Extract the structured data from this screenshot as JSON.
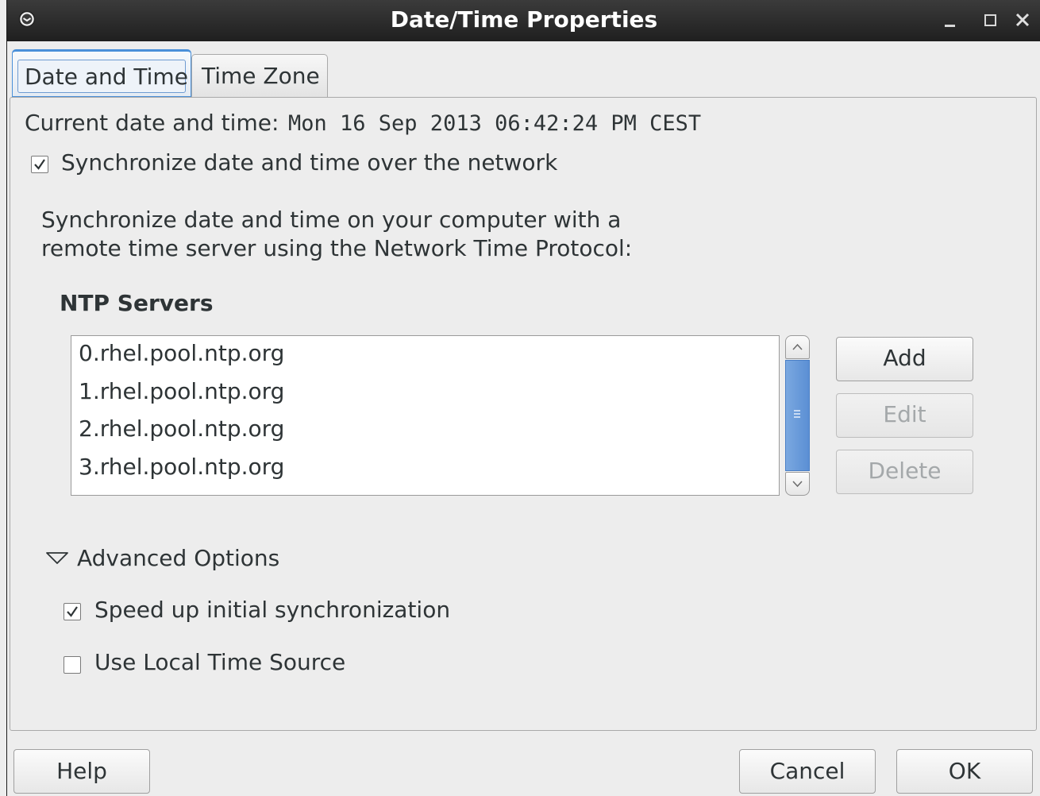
{
  "window": {
    "title": "Date/Time Properties"
  },
  "tabs": [
    {
      "label": "Date and Time",
      "active": true
    },
    {
      "label": "Time Zone",
      "active": false
    }
  ],
  "current": {
    "label": "Current date and time:",
    "value": "Mon 16 Sep 2013 06:42:24 PM CEST"
  },
  "sync": {
    "label": "Synchronize date and time over the network",
    "checked": true,
    "description_line1": "Synchronize date and time on your computer with a",
    "description_line2": "remote time server using the Network Time Protocol:"
  },
  "ntp": {
    "heading": "NTP Servers",
    "servers": [
      "0.rhel.pool.ntp.org",
      "1.rhel.pool.ntp.org",
      "2.rhel.pool.ntp.org",
      "3.rhel.pool.ntp.org"
    ],
    "add_label": "Add",
    "edit_label": "Edit",
    "delete_label": "Delete"
  },
  "advanced": {
    "label": "Advanced Options",
    "expanded": true,
    "speed_up_label": "Speed up initial synchronization",
    "speed_up_checked": true,
    "local_source_label": "Use Local Time Source",
    "local_source_checked": false
  },
  "footer": {
    "help_label": "Help",
    "cancel_label": "Cancel",
    "ok_label": "OK"
  },
  "colors": {
    "titlebar": "#2a2a2a",
    "accent": "#4a90d9",
    "scroll_thumb": "#6a9bdb"
  },
  "icons": [
    "window-menu-icon",
    "minimize-icon",
    "maximize-icon",
    "close-icon",
    "expander-open-icon",
    "checkmark-icon",
    "scroll-up-icon",
    "scroll-down-icon",
    "scroll-grip-icon"
  ]
}
